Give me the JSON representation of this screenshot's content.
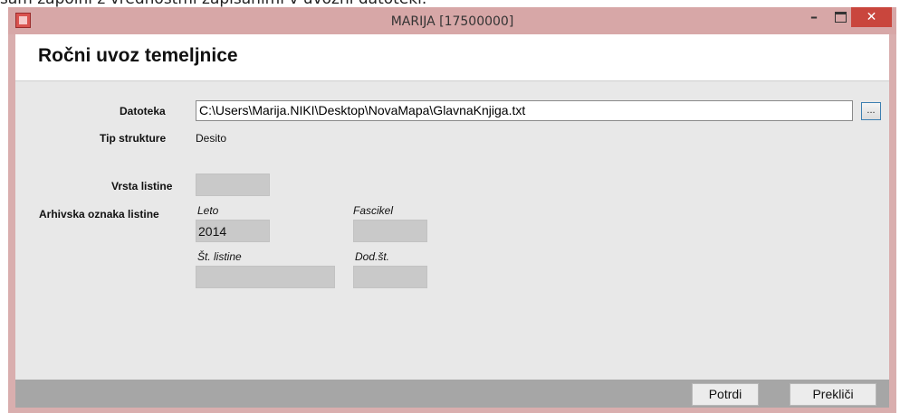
{
  "background_text": "sam zapolni z vrednostmi zapisanimi v uvozni datoteki.",
  "window": {
    "title": "MARIJA [17500000]",
    "controls": {
      "minimize": "–",
      "close": "✕"
    }
  },
  "header": {
    "title": "Ročni uvoz temeljnice"
  },
  "form": {
    "datoteka_label": "Datoteka",
    "datoteka_value": "C:\\Users\\Marija.NIKI\\Desktop\\NovaMapa\\GlavnaKnjiga.txt",
    "browse_label": "...",
    "tip_label": "Tip strukture",
    "tip_value": "Desito",
    "vrsta_label": "Vrsta listine",
    "vrsta_value": "",
    "arhivska_label": "Arhivska oznaka listine",
    "leto_label": "Leto",
    "leto_value": "2014",
    "fascikel_label": "Fascikel",
    "fascikel_value": "",
    "st_listine_label": "Št. listine",
    "st_listine_value": "",
    "dod_st_label": "Dod.št.",
    "dod_st_value": ""
  },
  "footer": {
    "confirm_label": "Potrdi",
    "cancel_label": "Prekliči"
  },
  "colors": {
    "titlebar": "#d7a7a7",
    "close": "#c9463d",
    "client": "#e8e8e8",
    "footer": "#a6a6a6"
  }
}
